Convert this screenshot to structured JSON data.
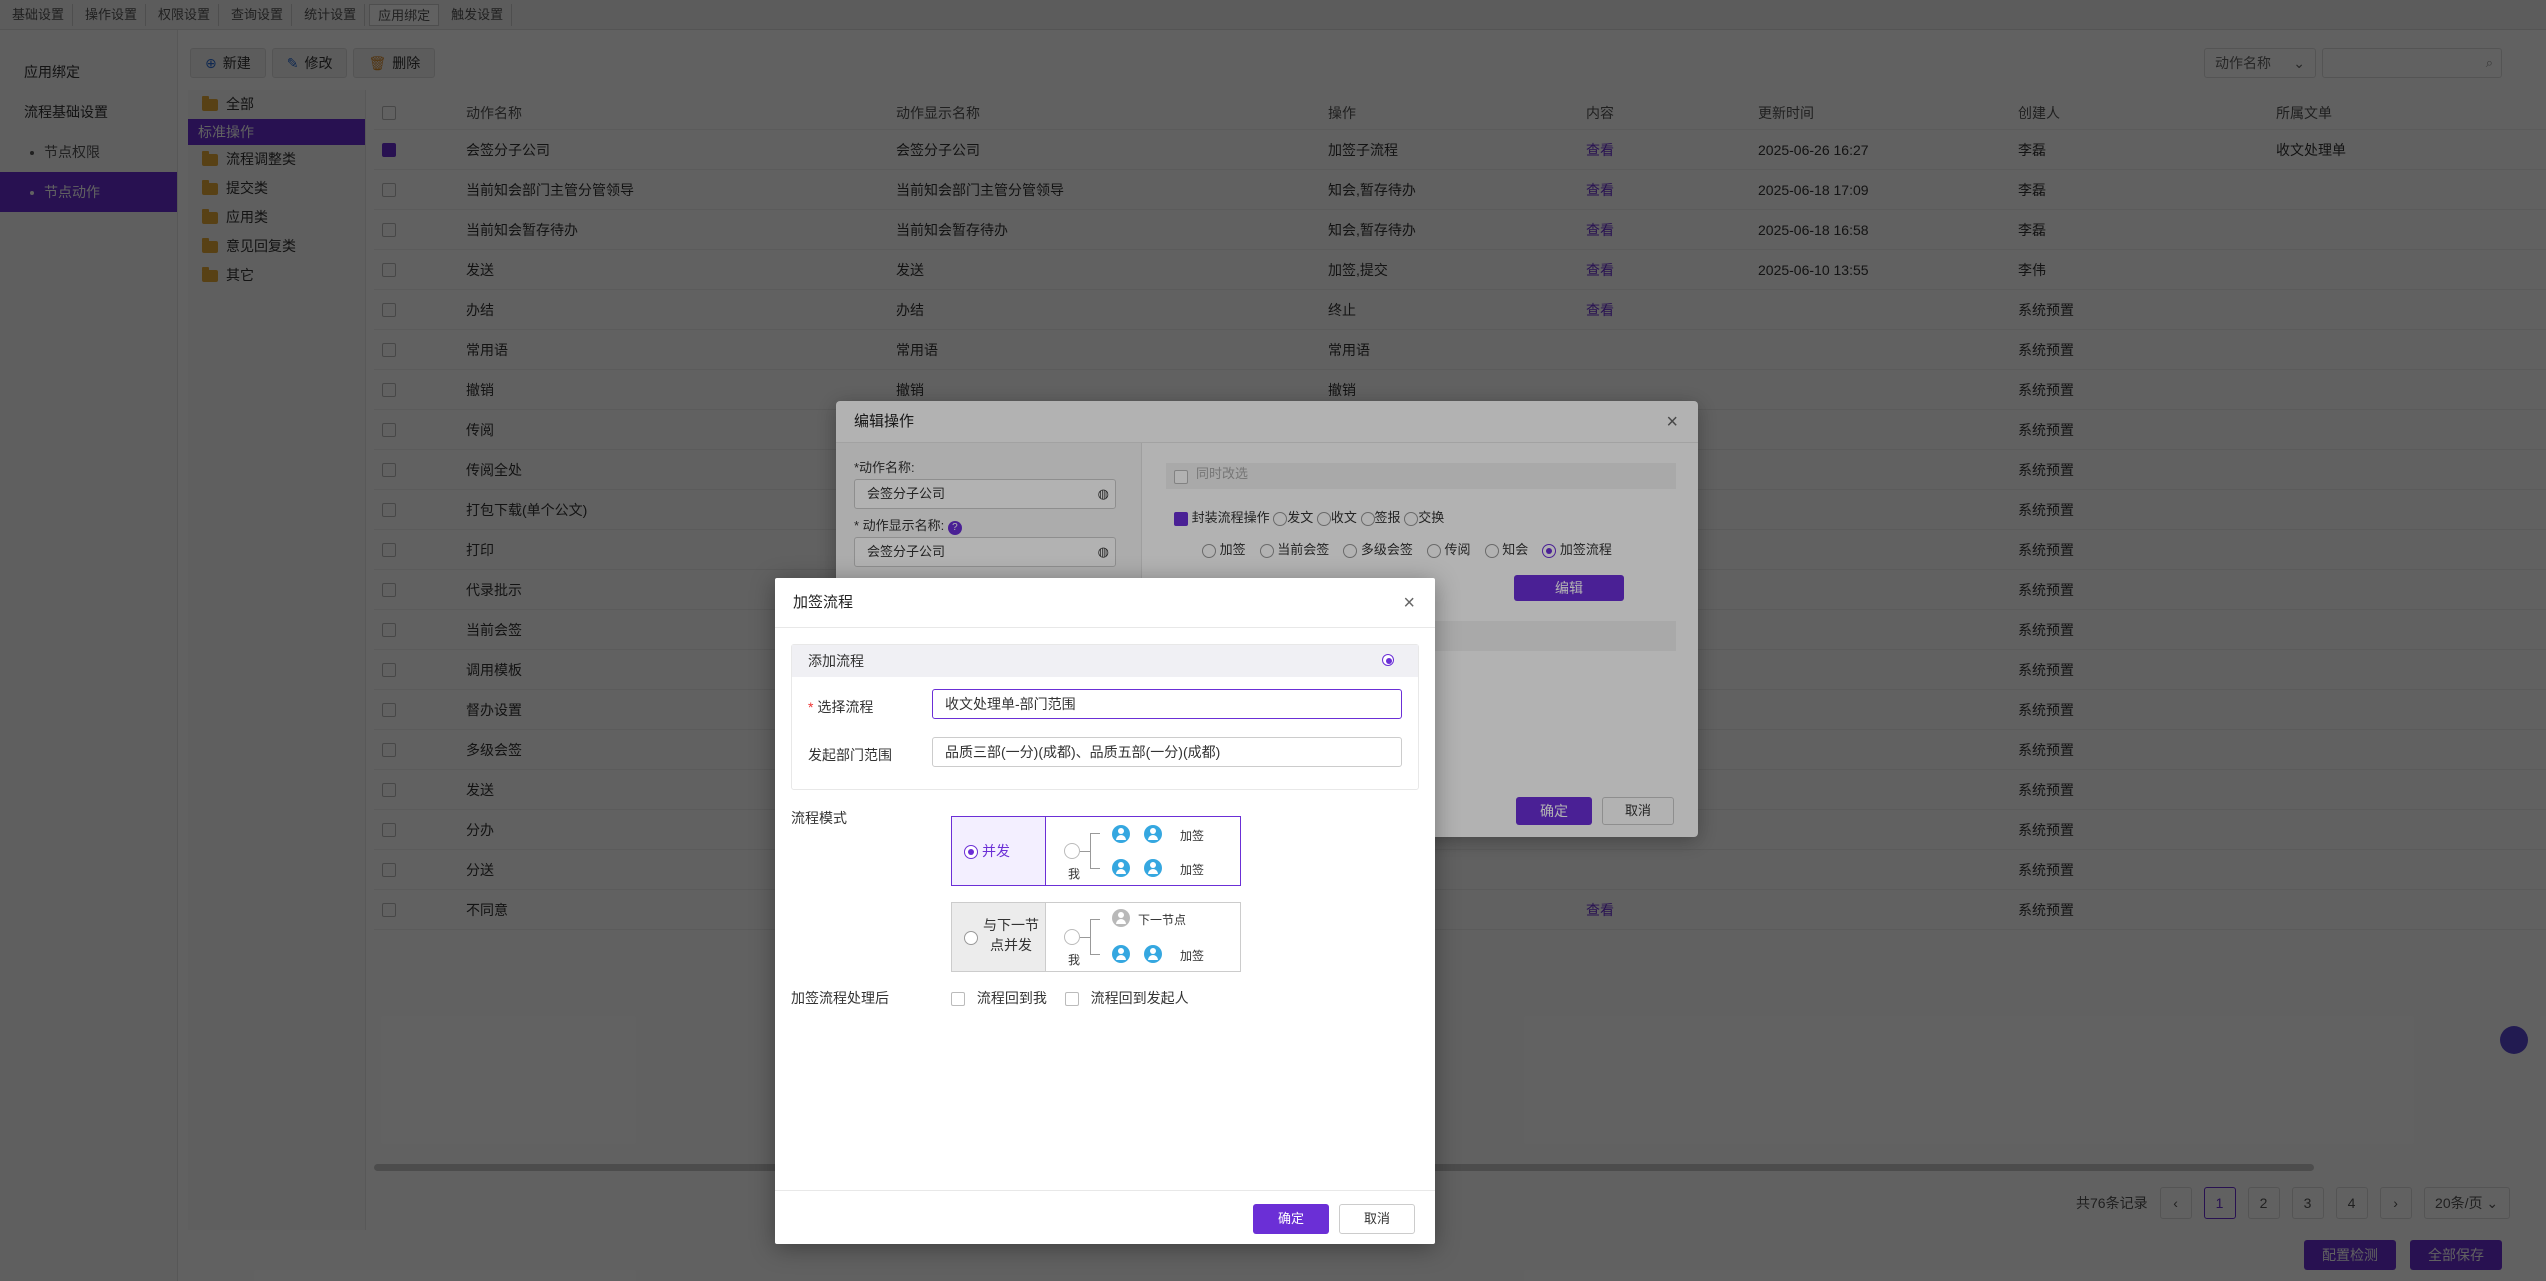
{
  "topnav": [
    "基础设置",
    "操作设置",
    "权限设置",
    "查询设置",
    "统计设置",
    "应用绑定",
    "触发设置"
  ],
  "leftmenu": {
    "items": [
      "应用绑定",
      "流程基础设置"
    ],
    "subs": [
      "节点权限",
      "节点动作"
    ]
  },
  "toolbar": {
    "new_label": "新建",
    "edit_label": "修改",
    "delete_label": "删除"
  },
  "tree": {
    "all": "全部",
    "standard": "标准操作",
    "children": [
      "流程调整类",
      "提交类",
      "应用类",
      "意见回复类",
      "其它"
    ]
  },
  "search": {
    "field_label": "动作名称"
  },
  "table": {
    "headers": [
      "动作名称",
      "动作显示名称",
      "操作",
      "内容",
      "更新时间",
      "创建人",
      "所属文单"
    ],
    "rows": [
      {
        "checked": true,
        "name": "会签分子公司",
        "display": "会签分子公司",
        "op": "加签子流程",
        "content": "查看",
        "time": "2025-06-26 16:27",
        "creator": "李磊",
        "doc": "收文处理单"
      },
      {
        "checked": false,
        "name": "当前知会部门主管分管领导",
        "display": "当前知会部门主管分管领导",
        "op": "知会,暂存待办",
        "content": "查看",
        "time": "2025-06-18 17:09",
        "creator": "李磊",
        "doc": ""
      },
      {
        "checked": false,
        "name": "当前知会暂存待办",
        "display": "当前知会暂存待办",
        "op": "知会,暂存待办",
        "content": "查看",
        "time": "2025-06-18 16:58",
        "creator": "李磊",
        "doc": ""
      },
      {
        "checked": false,
        "name": "发送",
        "display": "发送",
        "op": "加签,提交",
        "content": "查看",
        "time": "2025-06-10 13:55",
        "creator": "李伟",
        "doc": ""
      },
      {
        "checked": false,
        "name": "办结",
        "display": "办结",
        "op": "终止",
        "content": "查看",
        "time": "",
        "creator": "系统预置",
        "doc": ""
      },
      {
        "checked": false,
        "name": "常用语",
        "display": "常用语",
        "op": "常用语",
        "content": "",
        "time": "",
        "creator": "系统预置",
        "doc": ""
      },
      {
        "checked": false,
        "name": "撤销",
        "display": "撤销",
        "op": "撤销",
        "content": "",
        "time": "",
        "creator": "系统预置",
        "doc": ""
      },
      {
        "checked": false,
        "name": "传阅",
        "display": "",
        "op": "",
        "content": "",
        "time": "",
        "creator": "系统预置",
        "doc": ""
      },
      {
        "checked": false,
        "name": "传阅全处",
        "display": "",
        "op": "",
        "content": "",
        "time": "",
        "creator": "系统预置",
        "doc": ""
      },
      {
        "checked": false,
        "name": "打包下载(单个公文)",
        "display": "",
        "op": "",
        "content": "",
        "time": "",
        "creator": "系统预置",
        "doc": ""
      },
      {
        "checked": false,
        "name": "打印",
        "display": "",
        "op": "",
        "content": "",
        "time": "",
        "creator": "系统预置",
        "doc": ""
      },
      {
        "checked": false,
        "name": "代录批示",
        "display": "",
        "op": "",
        "content": "",
        "time": "",
        "creator": "系统预置",
        "doc": ""
      },
      {
        "checked": false,
        "name": "当前会签",
        "display": "",
        "op": "",
        "content": "",
        "time": "",
        "creator": "系统预置",
        "doc": ""
      },
      {
        "checked": false,
        "name": "调用模板",
        "display": "",
        "op": "",
        "content": "",
        "time": "",
        "creator": "系统预置",
        "doc": ""
      },
      {
        "checked": false,
        "name": "督办设置",
        "display": "",
        "op": "",
        "content": "",
        "time": "",
        "creator": "系统预置",
        "doc": ""
      },
      {
        "checked": false,
        "name": "多级会签",
        "display": "",
        "op": "",
        "content": "",
        "time": "",
        "creator": "系统预置",
        "doc": ""
      },
      {
        "checked": false,
        "name": "发送",
        "display": "",
        "op": "",
        "content": "",
        "time": "",
        "creator": "系统预置",
        "doc": ""
      },
      {
        "checked": false,
        "name": "分办",
        "display": "",
        "op": "",
        "content": "",
        "time": "",
        "creator": "系统预置",
        "doc": ""
      },
      {
        "checked": false,
        "name": "分送",
        "display": "",
        "op": "",
        "content": "",
        "time": "",
        "creator": "系统预置",
        "doc": ""
      },
      {
        "checked": false,
        "name": "不同意",
        "display": "",
        "op": "",
        "content": "查看",
        "time": "",
        "creator": "系统预置",
        "doc": ""
      }
    ]
  },
  "pager": {
    "total": "共76条记录",
    "pages": [
      "1",
      "2",
      "3",
      "4"
    ],
    "size": "20条/页"
  },
  "bottom": {
    "btn1": "配置检测",
    "btn2": "全部保存"
  },
  "editdlg": {
    "title": "编辑操作",
    "name_label": "*动作名称:",
    "name_value": "会签分子公司",
    "display_label": "* 动作显示名称:",
    "display_value": "会签分子公司",
    "top_row": "同时改选",
    "wrap_label": "封装流程操作",
    "wrap_opts": [
      "发文",
      "收文",
      "签报",
      "交换"
    ],
    "op_opts": [
      "加签",
      "当前会签",
      "多级会签",
      "传阅",
      "知会",
      "加签流程"
    ],
    "edit_btn": "编辑",
    "ok": "确定",
    "cancel": "取消"
  },
  "adddlg": {
    "title": "加签流程",
    "section": "添加流程",
    "select_label": "选择流程",
    "select_value": "收文处理单-部门范围",
    "dept_label": "发起部门范围",
    "dept_value": "品质三部(一分)(成都)、品质五部(一分)(成都)",
    "mode_label": "流程模式",
    "mode1": "并发",
    "mode2": "与下一节点并发",
    "me": "我",
    "add": "加签",
    "next": "下一节点",
    "after_label": "加签流程处理后",
    "opt1": "流程回到我",
    "opt2": "流程回到发起人",
    "ok": "确定",
    "cancel": "取消"
  },
  "colors": {
    "accent": "#6b2fd6",
    "person": "#35a7e0"
  }
}
